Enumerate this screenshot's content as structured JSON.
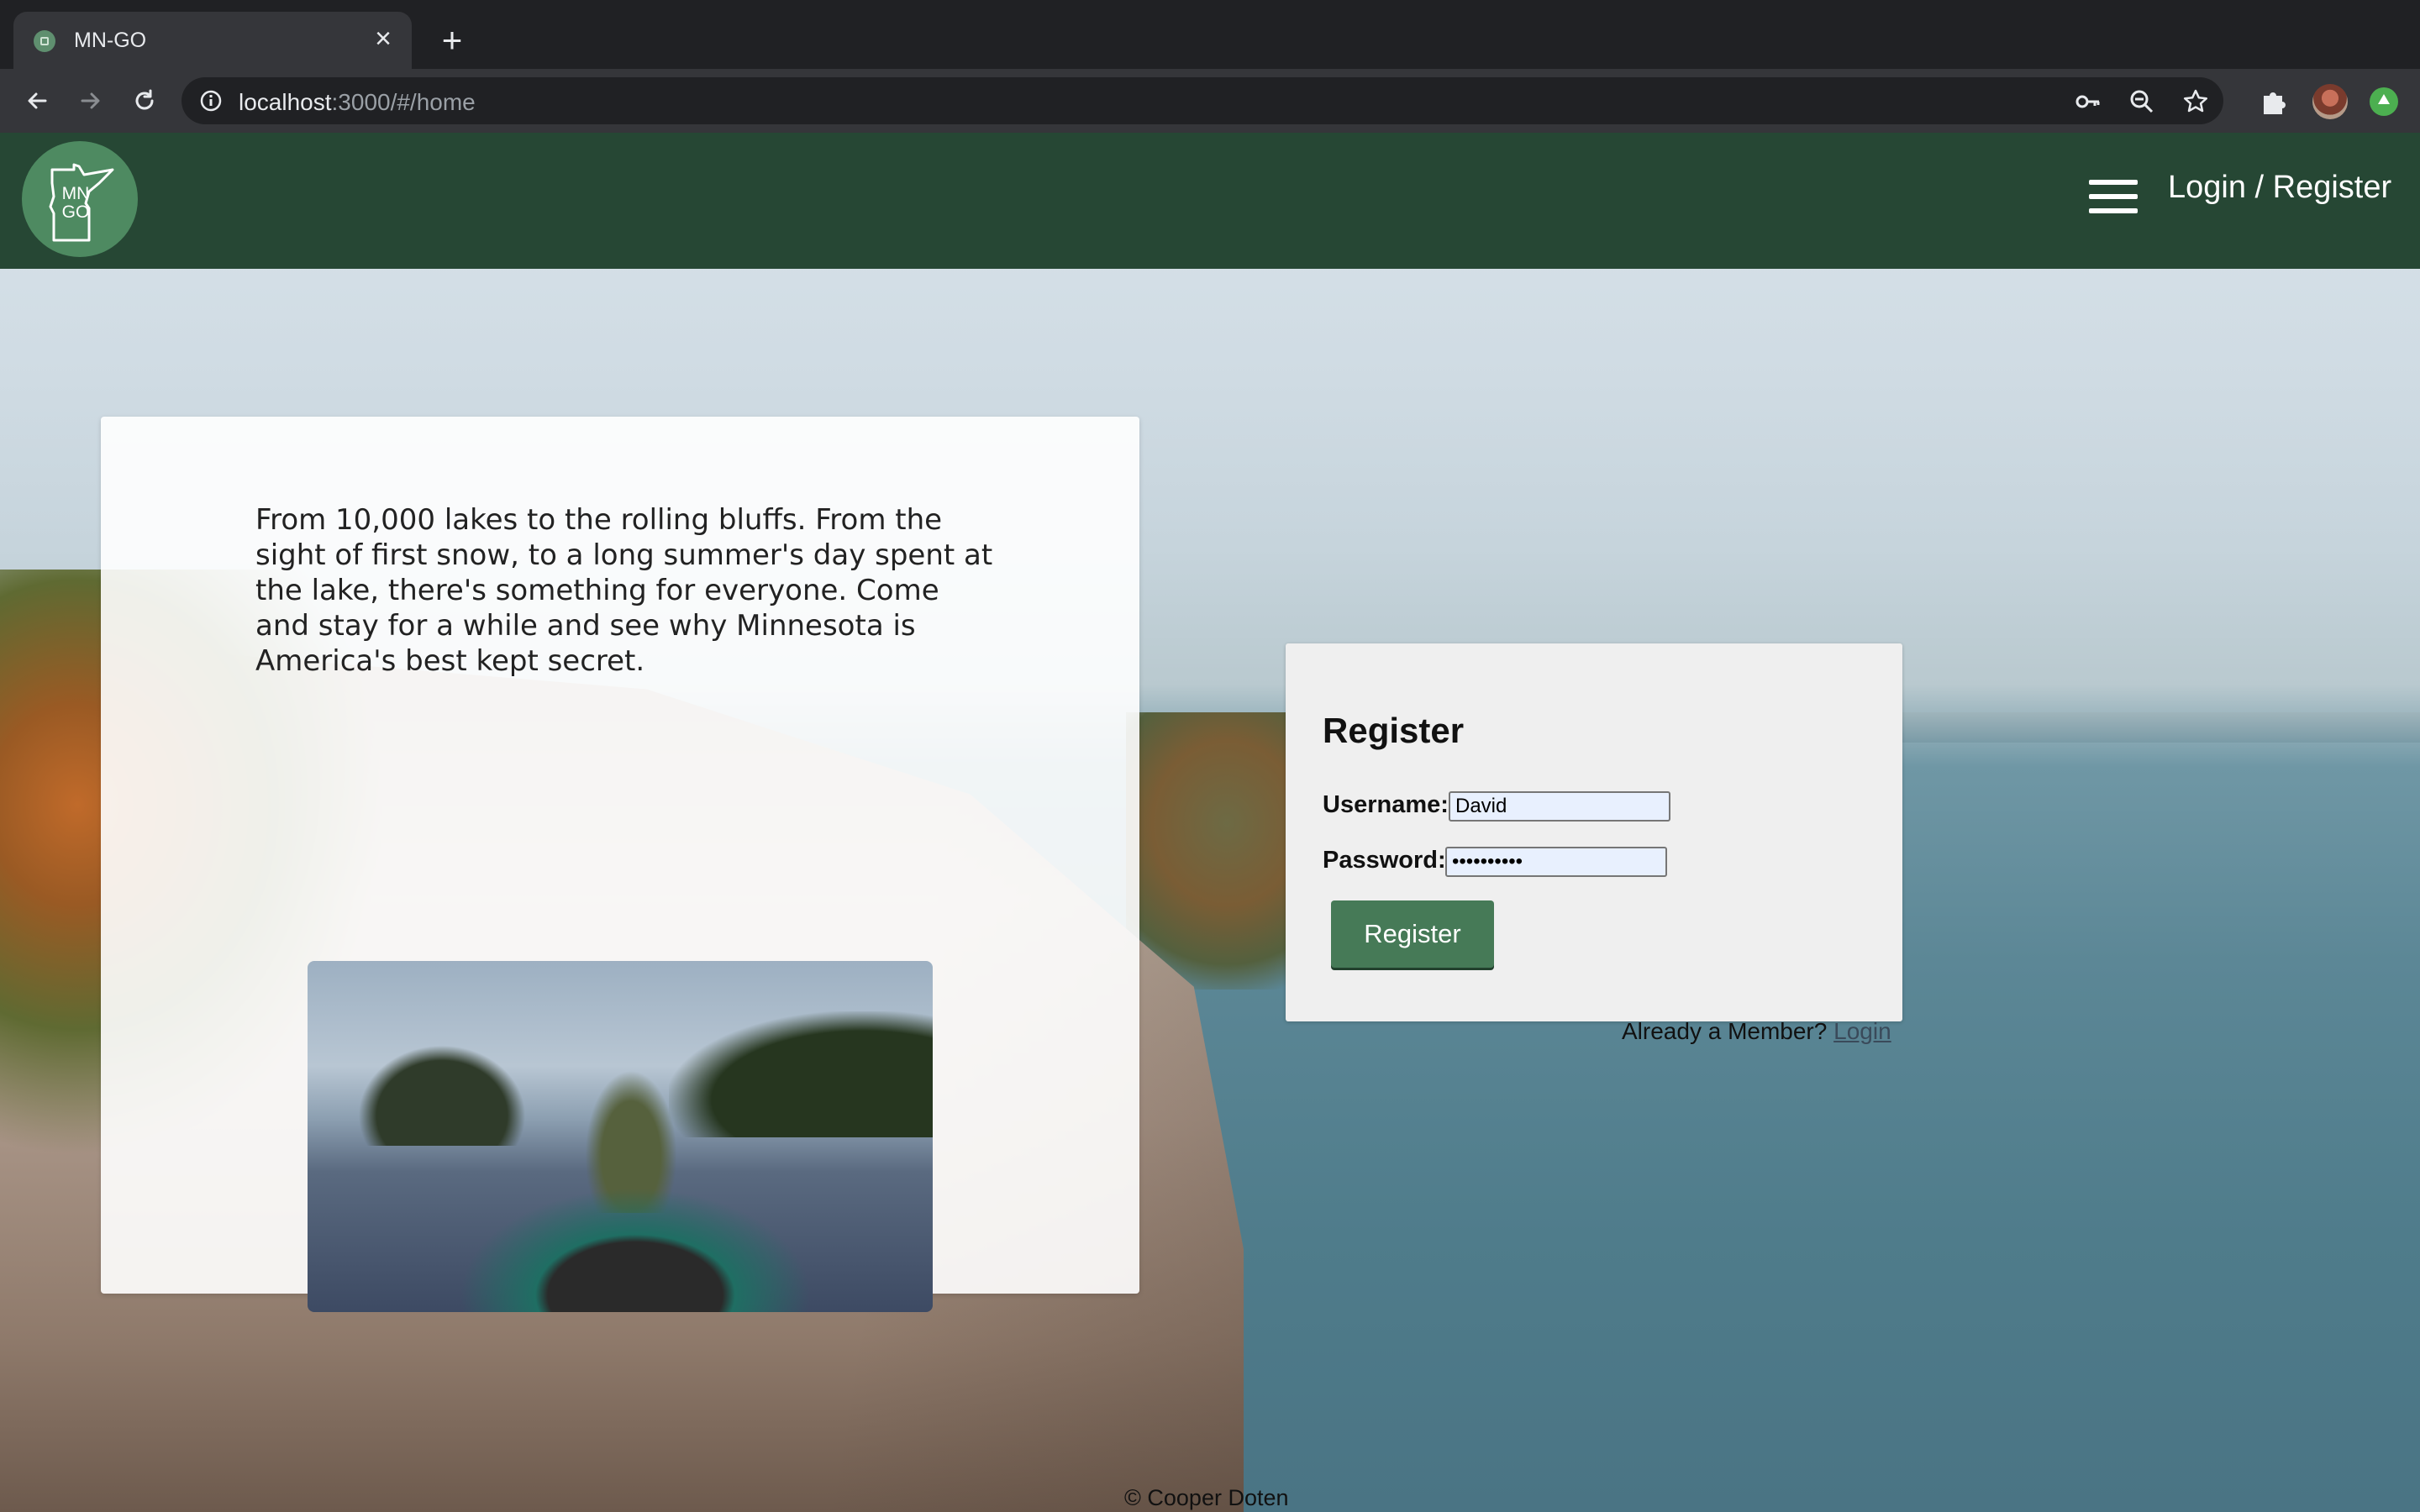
{
  "browser": {
    "tab_title": "MN-GO",
    "url_host": "localhost",
    "url_rest": ":3000/#/home"
  },
  "header": {
    "logo_line1": "MN",
    "logo_line2": "GO",
    "auth_link": "Login / Register"
  },
  "intro": {
    "text": "From 10,000 lakes to the rolling bluffs. From the sight of first snow, to a long summer's day spent at the lake, there's something for everyone. Come and stay for a while and see why Minnesota is America's best kept secret."
  },
  "register": {
    "title": "Register",
    "username_label": "Username:",
    "username_value": "David",
    "password_label": "Password:",
    "password_value": "••••••••••",
    "button_label": "Register",
    "member_prompt": "Already a Member?",
    "login_link": "Login"
  },
  "footer": {
    "copyright": "© Cooper Doten"
  },
  "colors": {
    "header_bg": "#264734",
    "logo_bg": "#4e8a61",
    "button_bg": "#467a57"
  },
  "icons": [
    "back-arrow-icon",
    "forward-arrow-icon",
    "reload-icon",
    "info-icon",
    "key-icon",
    "zoom-out-icon",
    "star-icon",
    "puzzle-icon",
    "menu-icon"
  ]
}
